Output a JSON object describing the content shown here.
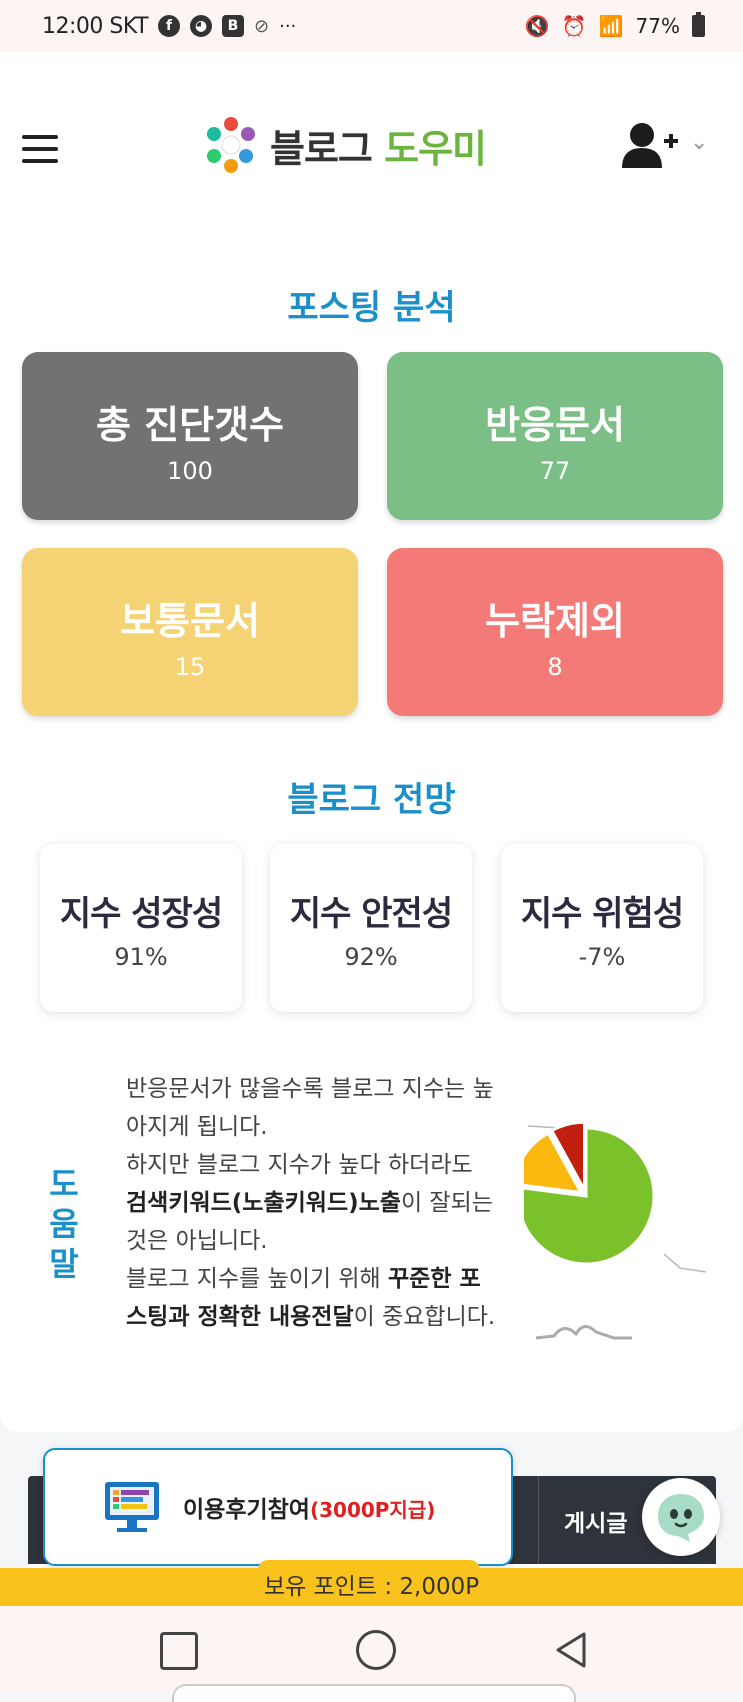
{
  "status_bar": {
    "time": "12:00 SKT",
    "battery": "77%"
  },
  "header": {
    "logo_part1": "블로그",
    "logo_part2": "도우미"
  },
  "posting_analysis": {
    "title": "포스팅 분석",
    "cards": [
      {
        "label": "총 진단갯수",
        "value": "100",
        "color": "#727272"
      },
      {
        "label": "반응문서",
        "value": "77",
        "color": "#7bbf87"
      },
      {
        "label": "보통문서",
        "value": "15",
        "color": "#f5d273"
      },
      {
        "label": "누락제외",
        "value": "8",
        "color": "#f47a77"
      }
    ]
  },
  "blog_outlook": {
    "title": "블로그 전망",
    "cards": [
      {
        "label": "지수 성장성",
        "value": "91%"
      },
      {
        "label": "지수 안전성",
        "value": "92%"
      },
      {
        "label": "지수 위험성",
        "value": "-7%"
      }
    ]
  },
  "help": {
    "tag": "도움말",
    "line1": "반응문서가 많을수록 블로그 지수는 높아지게 됩니다.",
    "line2_pre": "하지만 블로그 지수가 높다 하더라도 ",
    "line2_bold": "검색키워드(노출키워드)노출",
    "line2_post": "이 잘되는 것은 아닙니다.",
    "line3_pre": "블로그 지수를 높이기 위해 ",
    "line3_bold": "꾸준한 포스팅과 정확한 내용전달",
    "line3_post": "이 중요합니다."
  },
  "chart_data": {
    "type": "pie",
    "categories": [
      "반응문서",
      "보통문서",
      "누락제외"
    ],
    "values": [
      77,
      15,
      8
    ],
    "colors": [
      "#7bc12a",
      "#fbb80f",
      "#c1200e"
    ]
  },
  "table": {
    "column_label": "게시글"
  },
  "review_banner": {
    "label": "이용후기참여",
    "reward": "(3000P지급)"
  },
  "points_bar": {
    "text": "보유 포인트 : 2,000P"
  }
}
